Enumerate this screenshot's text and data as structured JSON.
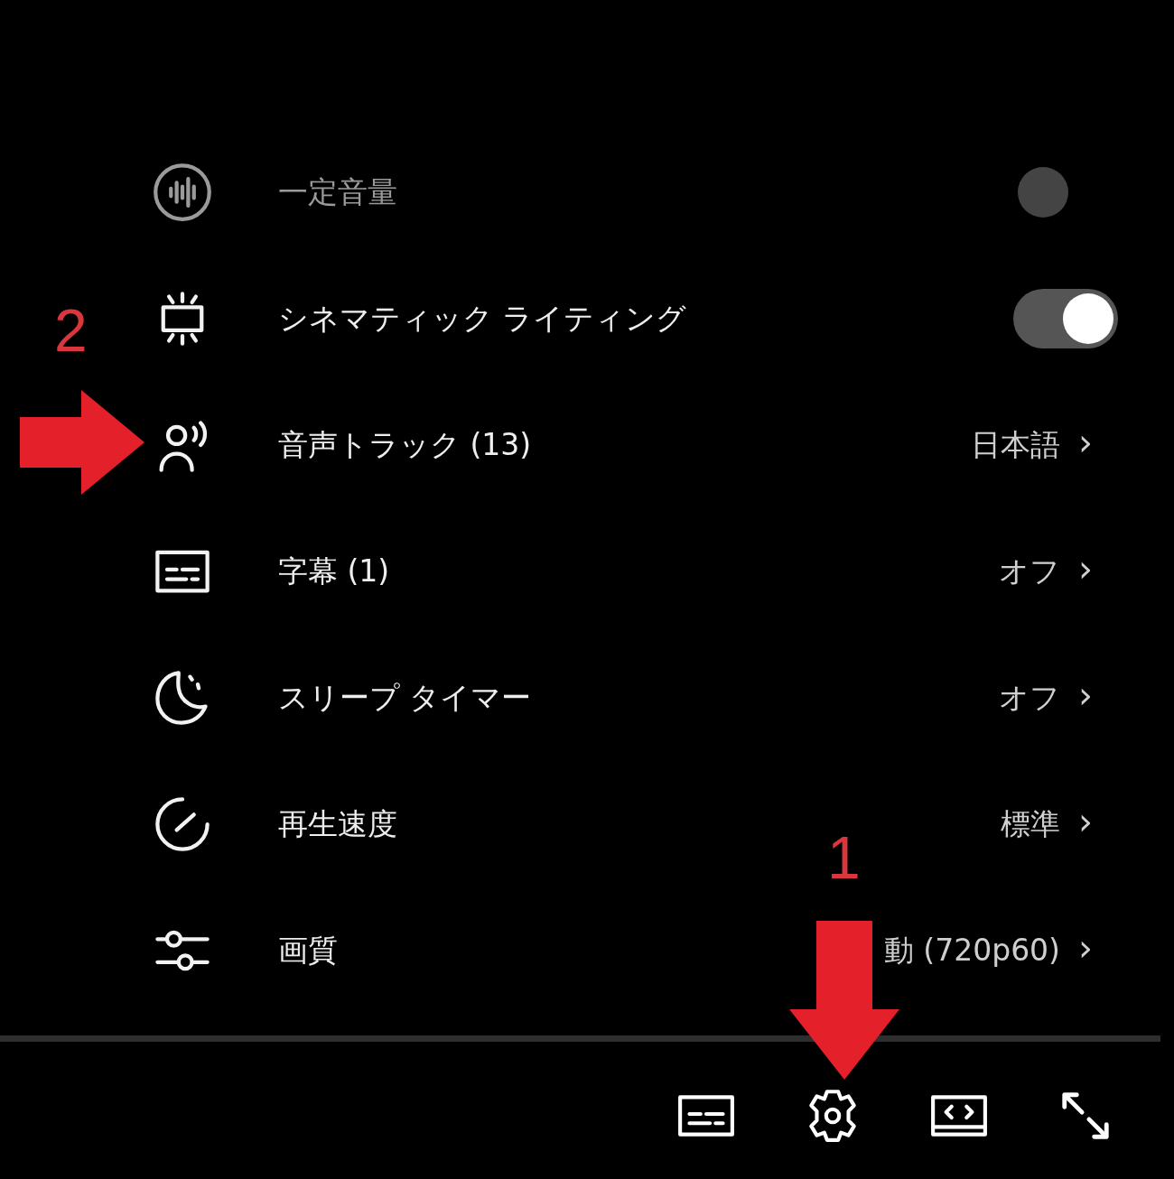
{
  "menu": {
    "items": [
      {
        "kind": "toggle",
        "label": "一定音量",
        "on": false,
        "disabled": true
      },
      {
        "kind": "toggle",
        "label": "シネマティック ライティング",
        "on": true,
        "disabled": false
      },
      {
        "kind": "submenu",
        "label": "音声トラック (13)",
        "value": "日本語",
        "chevron": "›"
      },
      {
        "kind": "submenu",
        "label": "字幕 (1)",
        "value": "オフ",
        "chevron": "›"
      },
      {
        "kind": "submenu",
        "label": "スリープ タイマー",
        "value": "オフ",
        "chevron": "›"
      },
      {
        "kind": "submenu",
        "label": "再生速度",
        "value": "標準",
        "chevron": "›"
      },
      {
        "kind": "submenu",
        "label": "画質",
        "value": "動 (720p60)",
        "chevron": "›"
      }
    ]
  },
  "annotations": [
    {
      "number": "2",
      "kind": "right"
    },
    {
      "number": "1",
      "kind": "down"
    }
  ]
}
